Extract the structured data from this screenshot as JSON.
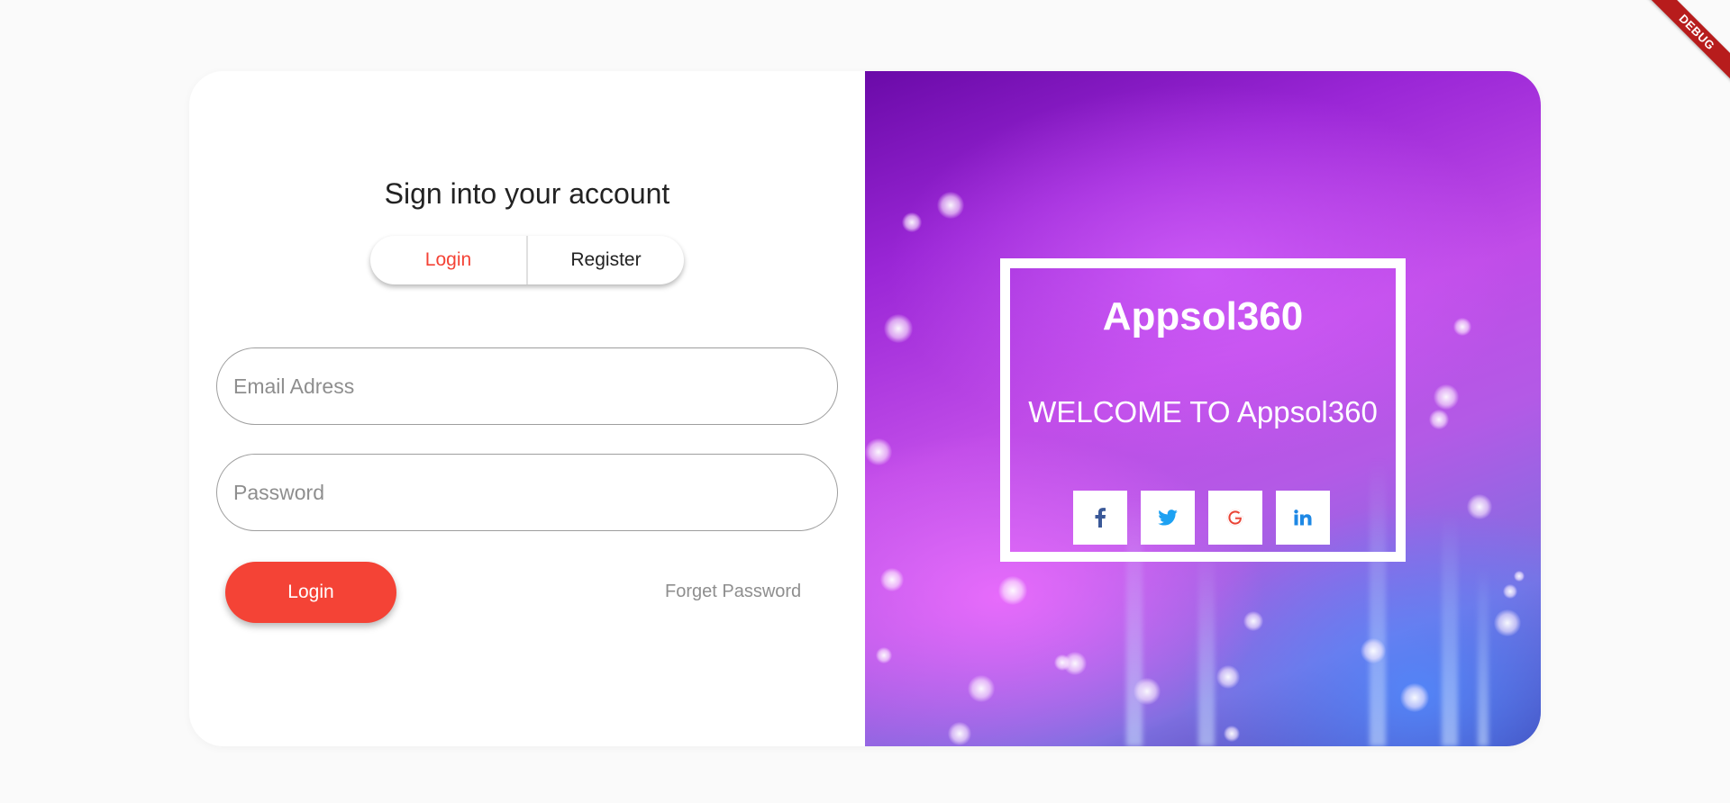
{
  "debug_banner": "DEBUG",
  "auth": {
    "heading": "Sign into your account",
    "tabs": {
      "login": "Login",
      "register": "Register"
    },
    "email_placeholder": "Email Adress",
    "password_placeholder": "Password",
    "login_button": "Login",
    "forget_password": "Forget Password"
  },
  "promo": {
    "brand": "Appsol360",
    "welcome": "WELCOME TO Appsol360",
    "socials": [
      "facebook-icon",
      "twitter-icon",
      "google-icon",
      "linkedin-icon"
    ]
  },
  "colors": {
    "accent": "#f44336",
    "facebook": "#3b5998",
    "twitter": "#1da1f2",
    "google": "#ea4335",
    "linkedin": "#1e88e5"
  }
}
